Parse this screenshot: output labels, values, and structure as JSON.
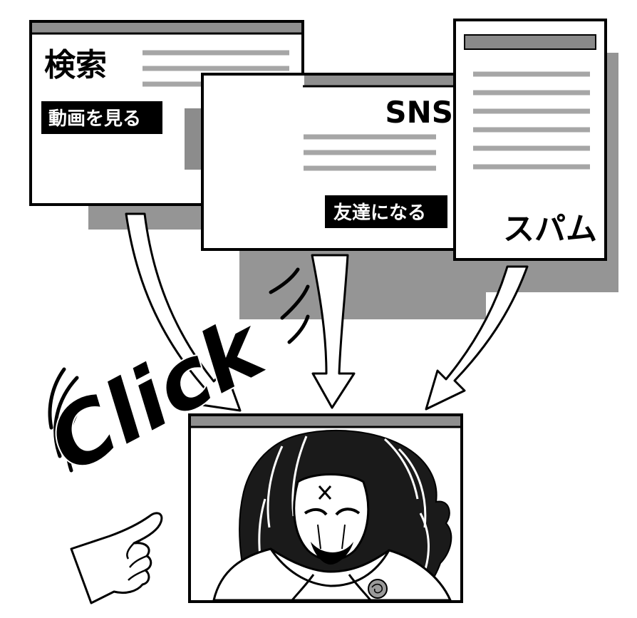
{
  "windows": {
    "search": {
      "title": "検索",
      "badge": "動画を見る"
    },
    "sns": {
      "title": "SNS",
      "badge": "友達になる"
    },
    "spam": {
      "title": "スパム"
    },
    "destination": {}
  },
  "click_text": "Click",
  "colors": {
    "ink": "#000000",
    "paper": "#ffffff",
    "shadow": "#959595",
    "titlebar": "#8f8f8f",
    "text_line": "#a6a6a6",
    "image_block": "#8c8c8c"
  },
  "icons": [
    "down-arrow-icon",
    "pointing-hand-icon",
    "motion-lines-icon",
    "hooded-figure-illustration"
  ]
}
